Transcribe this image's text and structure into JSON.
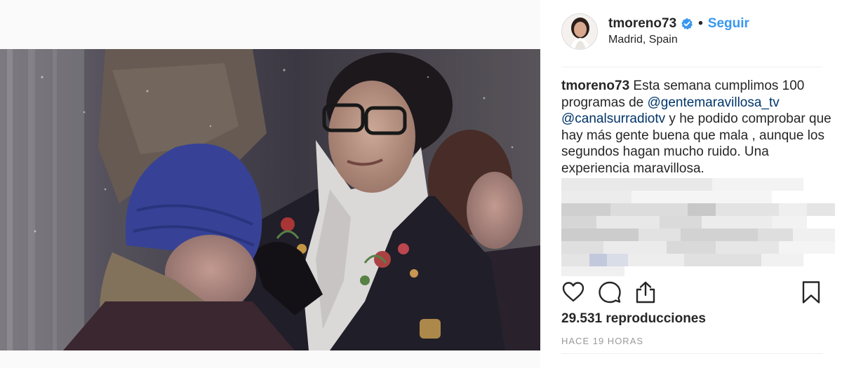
{
  "post": {
    "username": "tmoreno73",
    "follow_label": "Seguir",
    "location": "Madrid, Spain",
    "caption_user": "tmoreno73",
    "caption_part1": "Esta semana cumplimos 100 programas de",
    "mention1": "@gentemaravillosa_tv",
    "mention2": "@canalsurradiotv",
    "caption_part2": "y he podido comprobar que hay más gente buena que mala , aunque los segundos hagan mucho ruido. Una experiencia maravillosa.",
    "views": "29.531 reproducciones",
    "time": "HACE 19 HORAS"
  },
  "icons": {
    "verified": "verified-badge-icon",
    "like": "heart-icon",
    "comment": "comment-icon",
    "share": "share-icon",
    "save": "bookmark-icon"
  },
  "colors": {
    "accent": "#3897f0",
    "mention": "#003569",
    "text": "#262626",
    "muted": "#999999",
    "divider": "#efefef"
  }
}
